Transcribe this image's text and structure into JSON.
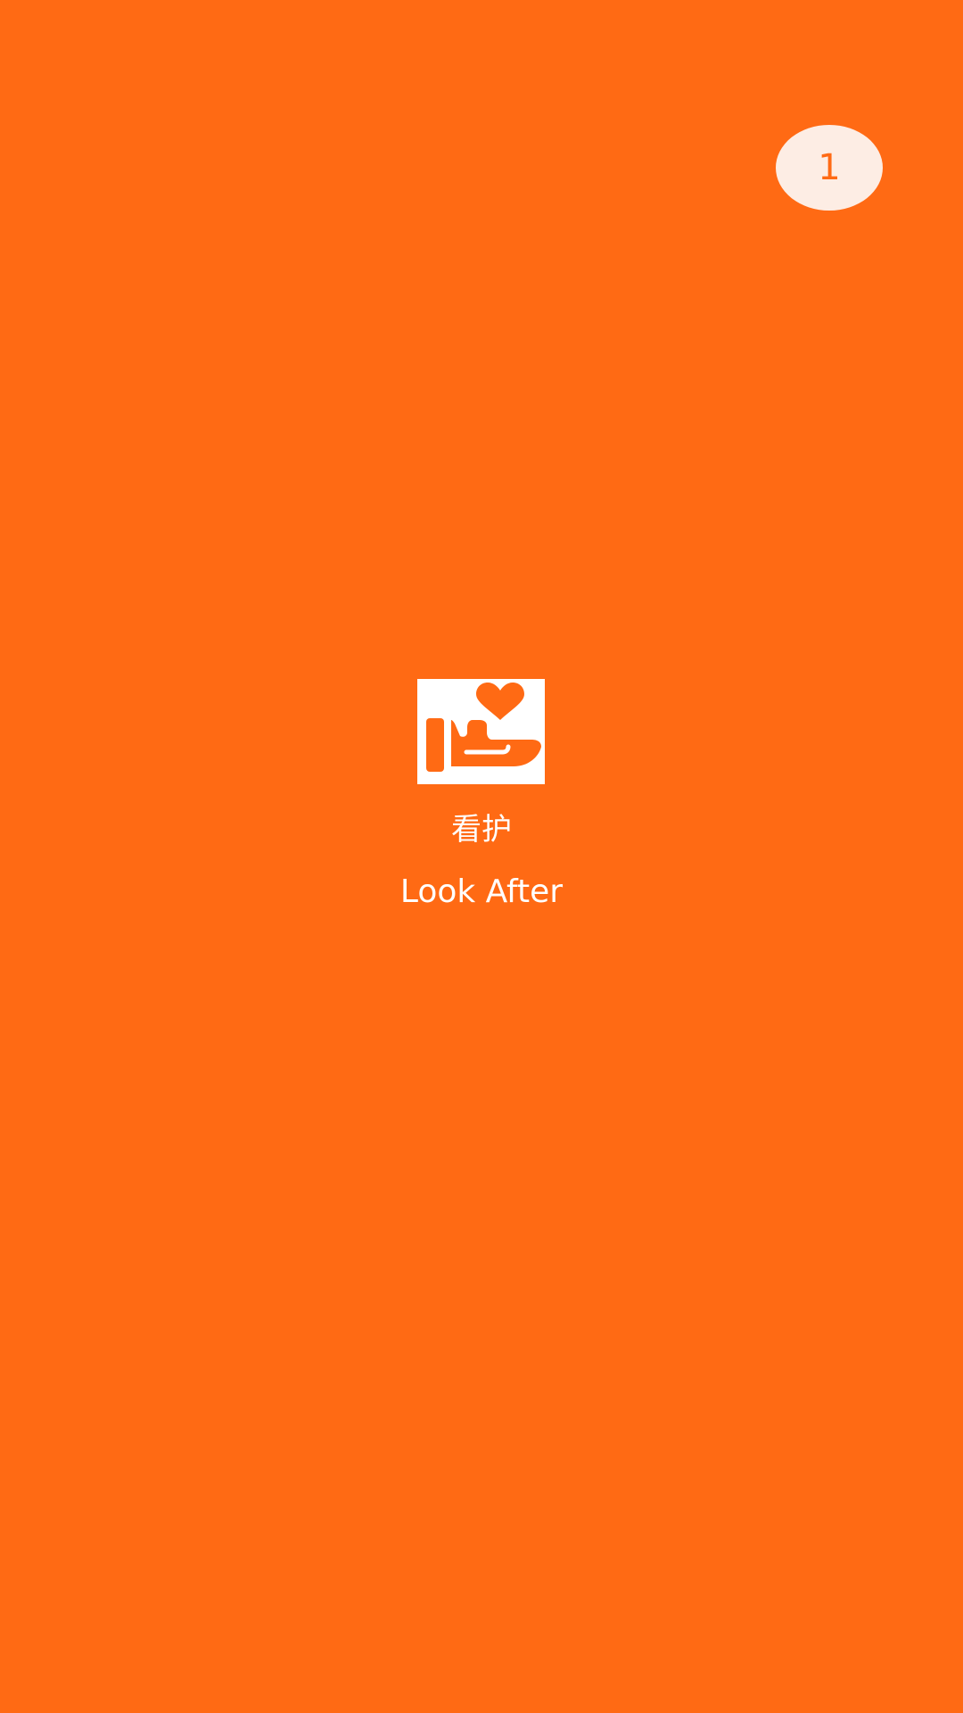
{
  "splash": {
    "skip_countdown": "1",
    "logo_icon": "hand-heart-icon",
    "title_cn": "看护",
    "title_en": "Look After"
  },
  "colors": {
    "background": "#FF6A14",
    "countdown_bg": "#FDEDE4",
    "logo_bg": "#FFFFFF",
    "text": "#FFFFFF"
  }
}
